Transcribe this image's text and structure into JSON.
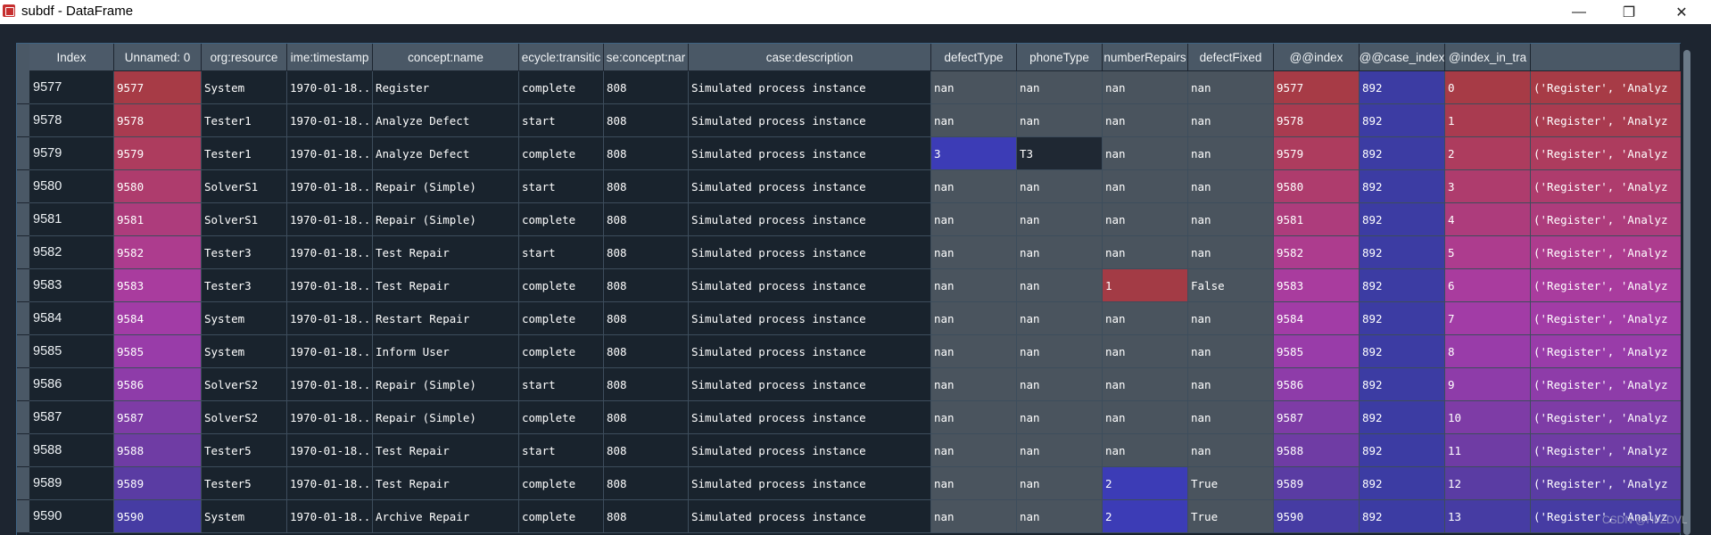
{
  "window": {
    "title": "subdf - DataFrame",
    "minimize_glyph": "—",
    "maximize_glyph": "❐",
    "close_glyph": "✕"
  },
  "table": {
    "index_header": "Index",
    "headers": [
      "Unnamed: 0",
      "org:resource",
      "ime:timestamp",
      "concept:name",
      "ecycle:transitic",
      "se:concept:nar",
      "case:description",
      "defectType",
      "phoneType",
      "numberRepairs",
      "defectFixed",
      "@@index",
      "@@case_index",
      "@index_in_tra",
      ""
    ],
    "rows": [
      {
        "index": "9577",
        "cells": [
          "9577",
          "System",
          "1970-01-18...",
          "Register",
          "complete",
          "808",
          "Simulated process instance",
          "nan",
          "nan",
          "nan",
          "nan",
          "9577",
          "892",
          "0",
          "('Register', 'Analyz"
        ]
      },
      {
        "index": "9578",
        "cells": [
          "9578",
          "Tester1",
          "1970-01-18...",
          "Analyze Defect",
          "start",
          "808",
          "Simulated process instance",
          "nan",
          "nan",
          "nan",
          "nan",
          "9578",
          "892",
          "1",
          "('Register', 'Analyz"
        ]
      },
      {
        "index": "9579",
        "cells": [
          "9579",
          "Tester1",
          "1970-01-18...",
          "Analyze Defect",
          "complete",
          "808",
          "Simulated process instance",
          "3",
          "T3",
          "nan",
          "nan",
          "9579",
          "892",
          "2",
          "('Register', 'Analyz"
        ]
      },
      {
        "index": "9580",
        "cells": [
          "9580",
          "SolverS1",
          "1970-01-18...",
          "Repair (Simple)",
          "start",
          "808",
          "Simulated process instance",
          "nan",
          "nan",
          "nan",
          "nan",
          "9580",
          "892",
          "3",
          "('Register', 'Analyz"
        ]
      },
      {
        "index": "9581",
        "cells": [
          "9581",
          "SolverS1",
          "1970-01-18...",
          "Repair (Simple)",
          "complete",
          "808",
          "Simulated process instance",
          "nan",
          "nan",
          "nan",
          "nan",
          "9581",
          "892",
          "4",
          "('Register', 'Analyz"
        ]
      },
      {
        "index": "9582",
        "cells": [
          "9582",
          "Tester3",
          "1970-01-18...",
          "Test Repair",
          "start",
          "808",
          "Simulated process instance",
          "nan",
          "nan",
          "nan",
          "nan",
          "9582",
          "892",
          "5",
          "('Register', 'Analyz"
        ]
      },
      {
        "index": "9583",
        "cells": [
          "9583",
          "Tester3",
          "1970-01-18...",
          "Test Repair",
          "complete",
          "808",
          "Simulated process instance",
          "nan",
          "nan",
          "1",
          "False",
          "9583",
          "892",
          "6",
          "('Register', 'Analyz"
        ]
      },
      {
        "index": "9584",
        "cells": [
          "9584",
          "System",
          "1970-01-18...",
          "Restart Repair",
          "complete",
          "808",
          "Simulated process instance",
          "nan",
          "nan",
          "nan",
          "nan",
          "9584",
          "892",
          "7",
          "('Register', 'Analyz"
        ]
      },
      {
        "index": "9585",
        "cells": [
          "9585",
          "System",
          "1970-01-18...",
          "Inform User",
          "complete",
          "808",
          "Simulated process instance",
          "nan",
          "nan",
          "nan",
          "nan",
          "9585",
          "892",
          "8",
          "('Register', 'Analyz"
        ]
      },
      {
        "index": "9586",
        "cells": [
          "9586",
          "SolverS2",
          "1970-01-18...",
          "Repair (Simple)",
          "start",
          "808",
          "Simulated process instance",
          "nan",
          "nan",
          "nan",
          "nan",
          "9586",
          "892",
          "9",
          "('Register', 'Analyz"
        ]
      },
      {
        "index": "9587",
        "cells": [
          "9587",
          "SolverS2",
          "1970-01-18...",
          "Repair (Simple)",
          "complete",
          "808",
          "Simulated process instance",
          "nan",
          "nan",
          "nan",
          "nan",
          "9587",
          "892",
          "10",
          "('Register', 'Analyz"
        ]
      },
      {
        "index": "9588",
        "cells": [
          "9588",
          "Tester5",
          "1970-01-18...",
          "Test Repair",
          "start",
          "808",
          "Simulated process instance",
          "nan",
          "nan",
          "nan",
          "nan",
          "9588",
          "892",
          "11",
          "('Register', 'Analyz"
        ]
      },
      {
        "index": "9589",
        "cells": [
          "9589",
          "Tester5",
          "1970-01-18...",
          "Test Repair",
          "complete",
          "808",
          "Simulated process instance",
          "nan",
          "nan",
          "2",
          "True",
          "9589",
          "892",
          "12",
          "('Register', 'Analyz"
        ]
      },
      {
        "index": "9590",
        "cells": [
          "9590",
          "System",
          "1970-01-18...",
          "Archive Repair",
          "complete",
          "808",
          "Simulated process instance",
          "nan",
          "nan",
          "2",
          "True",
          "9590",
          "892",
          "13",
          "('Register', 'Analyz"
        ]
      }
    ],
    "gradient_colors": [
      "#a73b46",
      "#a93b50",
      "#ad3c5e",
      "#ae3c6d",
      "#ad3c7c",
      "#ad3c8e",
      "#a93c9e",
      "#a23ca6",
      "#993ca9",
      "#8e3ca9",
      "#7e3ca6",
      "#6f3ca4",
      "#5a3ca3",
      "#463ca3"
    ],
    "case_index_color": "#3c3ca3",
    "special_colors": {
      "defect_type_r2": "#3c3cb6",
      "phone_type_r2": "#1f2833",
      "repairs_r6": "#a33b45",
      "repairs_r12": "#3c3cb6",
      "repairs_r13": "#3c3cb6"
    }
  },
  "watermark": "CSDN @Hi-ZDVL"
}
